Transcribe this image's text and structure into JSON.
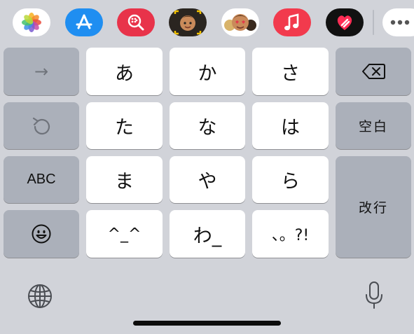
{
  "app_strip": {
    "apps": [
      {
        "name": "Photos",
        "icon": "photos-icon",
        "bg": "#ffffff"
      },
      {
        "name": "App Store",
        "icon": "app-store-icon",
        "bg": "#1f8ef1"
      },
      {
        "name": "Images Search",
        "icon": "image-search-icon",
        "bg": "#e8334a"
      },
      {
        "name": "Memoji",
        "icon": "memoji-icon",
        "bg": "#e3b03a"
      },
      {
        "name": "Memoji Stickers",
        "icon": "memoji-stickers-icon",
        "bg": "#ffffff"
      },
      {
        "name": "Music",
        "icon": "music-icon",
        "bg": "#f23a4d"
      },
      {
        "name": "Digital Touch",
        "icon": "digital-touch-icon",
        "bg": "#111111"
      },
      {
        "name": "More",
        "icon": "more-icon",
        "bg": "#ffffff"
      }
    ]
  },
  "keyboard": {
    "row1": {
      "left": "→",
      "k1": "あ",
      "k2": "か",
      "k3": "さ",
      "right_icon": "delete-icon"
    },
    "row2": {
      "left_icon": "undo-icon",
      "k1": "た",
      "k2": "な",
      "k3": "は",
      "right": "空白"
    },
    "row3": {
      "left": "ABC",
      "k1": "ま",
      "k2": "や",
      "k3": "ら",
      "return": "改行"
    },
    "row4": {
      "left_icon": "emoji-icon",
      "k1": "^_^",
      "k2": "わ_",
      "k3": "、。?!"
    }
  },
  "bottom": {
    "globe": "globe-icon",
    "mic": "microphone-icon"
  },
  "colors": {
    "keyboard_bg": "#d1d3d9",
    "char_key": "#ffffff",
    "func_key": "#abb0ba"
  }
}
